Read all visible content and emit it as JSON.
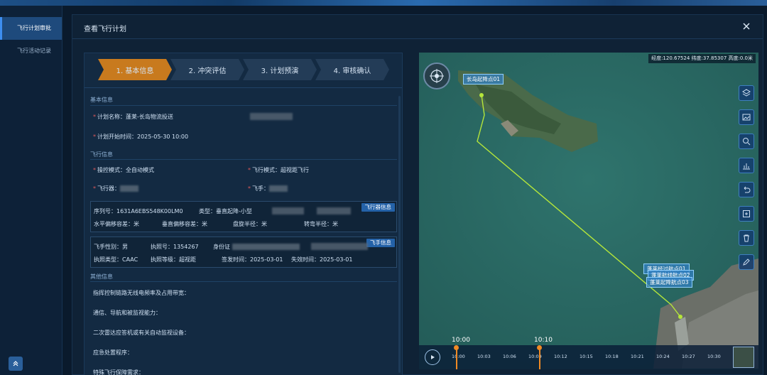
{
  "sidebar": {
    "items": [
      {
        "label": "飞行计划审批"
      },
      {
        "label": "飞行活动记录"
      }
    ]
  },
  "dialog": {
    "title": "查看飞行计划"
  },
  "steps": [
    {
      "label": "1. 基本信息"
    },
    {
      "label": "2. 冲突评估"
    },
    {
      "label": "3. 计划预演"
    },
    {
      "label": "4. 审核确认"
    }
  ],
  "basic": {
    "section_title": "基本信息",
    "plan_name_label": "计划名称：",
    "plan_name_value": "蓬莱-长岛物流投送",
    "start_time_label": "计划开始时间：",
    "start_time_value": "2025-05-30 10:00"
  },
  "flight": {
    "section_title": "飞行信息",
    "control_mode_label": "操控模式：",
    "control_mode_value": "全自动模式",
    "flight_mode_label": "飞行模式：",
    "flight_mode_value": "超视距飞行",
    "aircraft_label": "飞行器：",
    "pilot_label": "飞手："
  },
  "aircraft_box": {
    "tag": "飞行器信息",
    "serial_label": "序列号：",
    "serial_value": "1631A6EBS548K00LM0",
    "type_label": "类型：",
    "type_value": "垂直起降-小型",
    "h_tol": "水平偏移容差：米",
    "v_tol": "垂直偏移容差：米",
    "hover_radius": "盘旋半径：米",
    "turn_radius": "转弯半径：米"
  },
  "pilot_box": {
    "tag": "飞手信息",
    "gender": "飞手性别：男",
    "license_no": "执照号：1354267",
    "id_label": "身份证",
    "license_type": "执照类型：CAAC",
    "license_level": "执照等级：超视距",
    "issue_date": "签发时间：2025-03-01",
    "expire_date": "失效时间：2025-03-01"
  },
  "other": {
    "section_title": "其他信息",
    "items": [
      "指挥控制链路无线电频率及占用带宽：",
      "通信、导航和被监视能力：",
      "二次雷达应答机或有关自动监视设备：",
      "应急处置程序：",
      "特殊飞行保障需求："
    ]
  },
  "map": {
    "coord_text": "经度:120.67524 纬度:37.85307 高度:0.0米",
    "waypoint_start": "长岛起降点01",
    "waypoint_end_1": "蓬莱经过航点01",
    "waypoint_end_2": "蓬莱航线航点02",
    "waypoint_end_3": "蓬莱起降航点03",
    "tools": [
      "layers-icon",
      "image-icon",
      "search-icon",
      "chart-icon",
      "undo-icon",
      "box-select-icon",
      "delete-icon",
      "edit-icon"
    ],
    "timeline": {
      "current_start": "10:00",
      "current_end": "10:10",
      "ticks": [
        "10:00",
        "10:03",
        "10:06",
        "10:09",
        "10:12",
        "10:15",
        "10:18",
        "10:21",
        "10:24",
        "10:27",
        "10:30"
      ]
    }
  },
  "colors": {
    "accent": "#3d8ef0",
    "active_step": "#c87a1e",
    "route": "#b5e63a",
    "required": "#e05a5a"
  }
}
